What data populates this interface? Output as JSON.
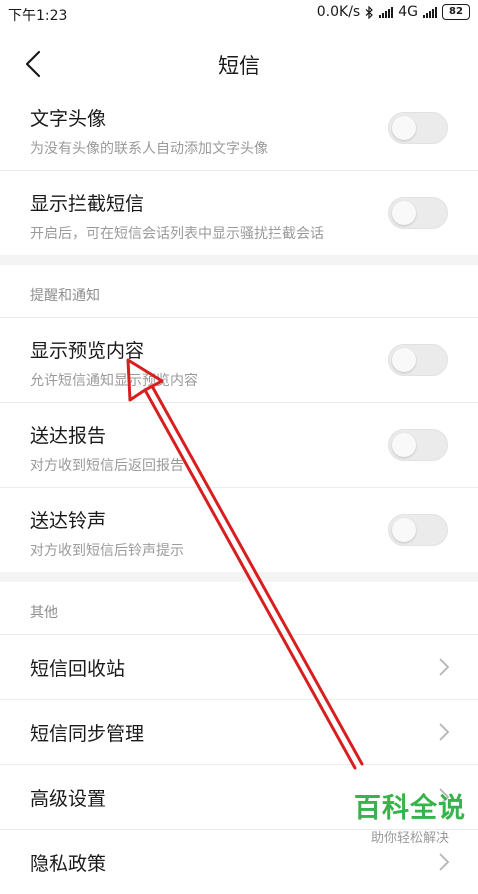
{
  "status_bar": {
    "time": "下午1:23",
    "net_speed": "0.0K/s",
    "network": "4G",
    "battery": "82"
  },
  "header": {
    "title": "短信"
  },
  "cards": [
    {
      "rows": [
        {
          "title": "文字头像",
          "subtitle": "为没有头像的联系人自动添加文字头像",
          "control": "toggle",
          "on": false
        },
        {
          "title": "显示拦截短信",
          "subtitle": "开启后，可在短信会话列表中显示骚扰拦截会话",
          "control": "toggle",
          "on": false
        }
      ]
    },
    {
      "section": "提醒和通知",
      "rows": [
        {
          "title": "显示预览内容",
          "subtitle": "允许短信通知显示预览内容",
          "control": "toggle",
          "on": false
        },
        {
          "title": "送达报告",
          "subtitle": "对方收到短信后返回报告",
          "control": "toggle",
          "on": false
        },
        {
          "title": "送达铃声",
          "subtitle": "对方收到短信后铃声提示",
          "control": "toggle",
          "on": false
        }
      ]
    },
    {
      "section": "其他",
      "rows": [
        {
          "title": "短信回收站",
          "control": "chevron"
        },
        {
          "title": "短信同步管理",
          "control": "chevron"
        },
        {
          "title": "高级设置",
          "control": "chevron"
        },
        {
          "title": "隐私政策",
          "control": "chevron"
        }
      ]
    }
  ],
  "watermark": {
    "title": "百科全说",
    "subtitle": "助你轻松解决"
  },
  "colors": {
    "arrow": "#d81e1e",
    "watermark": "#36b34a",
    "toggle_off": "#ebebeb"
  }
}
